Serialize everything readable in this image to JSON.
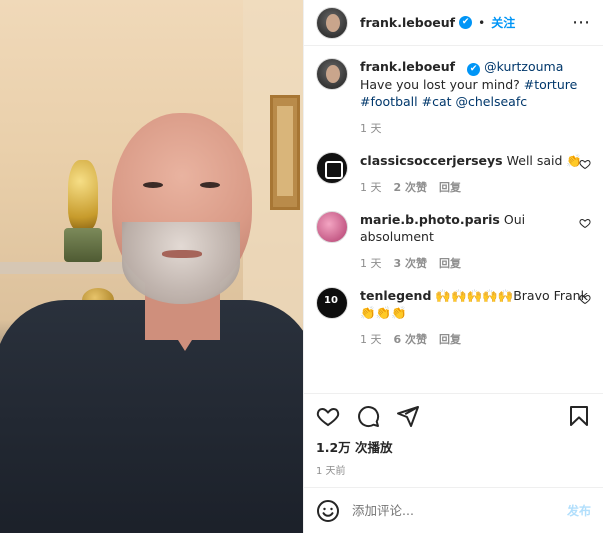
{
  "header": {
    "username": "frank.leboeuf",
    "verified_mark": "✔",
    "dot": "•",
    "follow_label": "关注",
    "more_label": "⋮⋮⋮"
  },
  "caption": {
    "username": "frank.leboeuf",
    "text_parts": [
      "@kurtzouma",
      " Have you lost your mind? ",
      "#torture",
      " ",
      "#football",
      " ",
      "#cat",
      " ",
      "@chelseafc"
    ],
    "time": "1 天"
  },
  "comments": [
    {
      "username": "classicsoccerjerseys",
      "text": "Well said 👏",
      "time": "1 天",
      "likes": "2 次赞",
      "reply": "回复"
    },
    {
      "username": "marie.b.photo.paris",
      "text": "Oui absolument",
      "time": "1 天",
      "likes": "3 次赞",
      "reply": "回复"
    },
    {
      "username": "tenlegend",
      "text": "🙌🙌🙌🙌🙌Bravo Frank👏👏👏",
      "time": "1 天",
      "likes": "6 次赞",
      "reply": "回复"
    }
  ],
  "stats": {
    "views": "1.2万 次播放",
    "posted": "1 天前"
  },
  "composer": {
    "placeholder": "添加评论...",
    "post_label": "发布"
  },
  "colors": {
    "accent": "#0095f6",
    "muted": "#8e8e8e",
    "link": "#00376b"
  },
  "icons": [
    "heart-icon",
    "comment-icon",
    "share-icon",
    "bookmark-icon",
    "emoji-icon",
    "more-icon",
    "verified-icon"
  ]
}
